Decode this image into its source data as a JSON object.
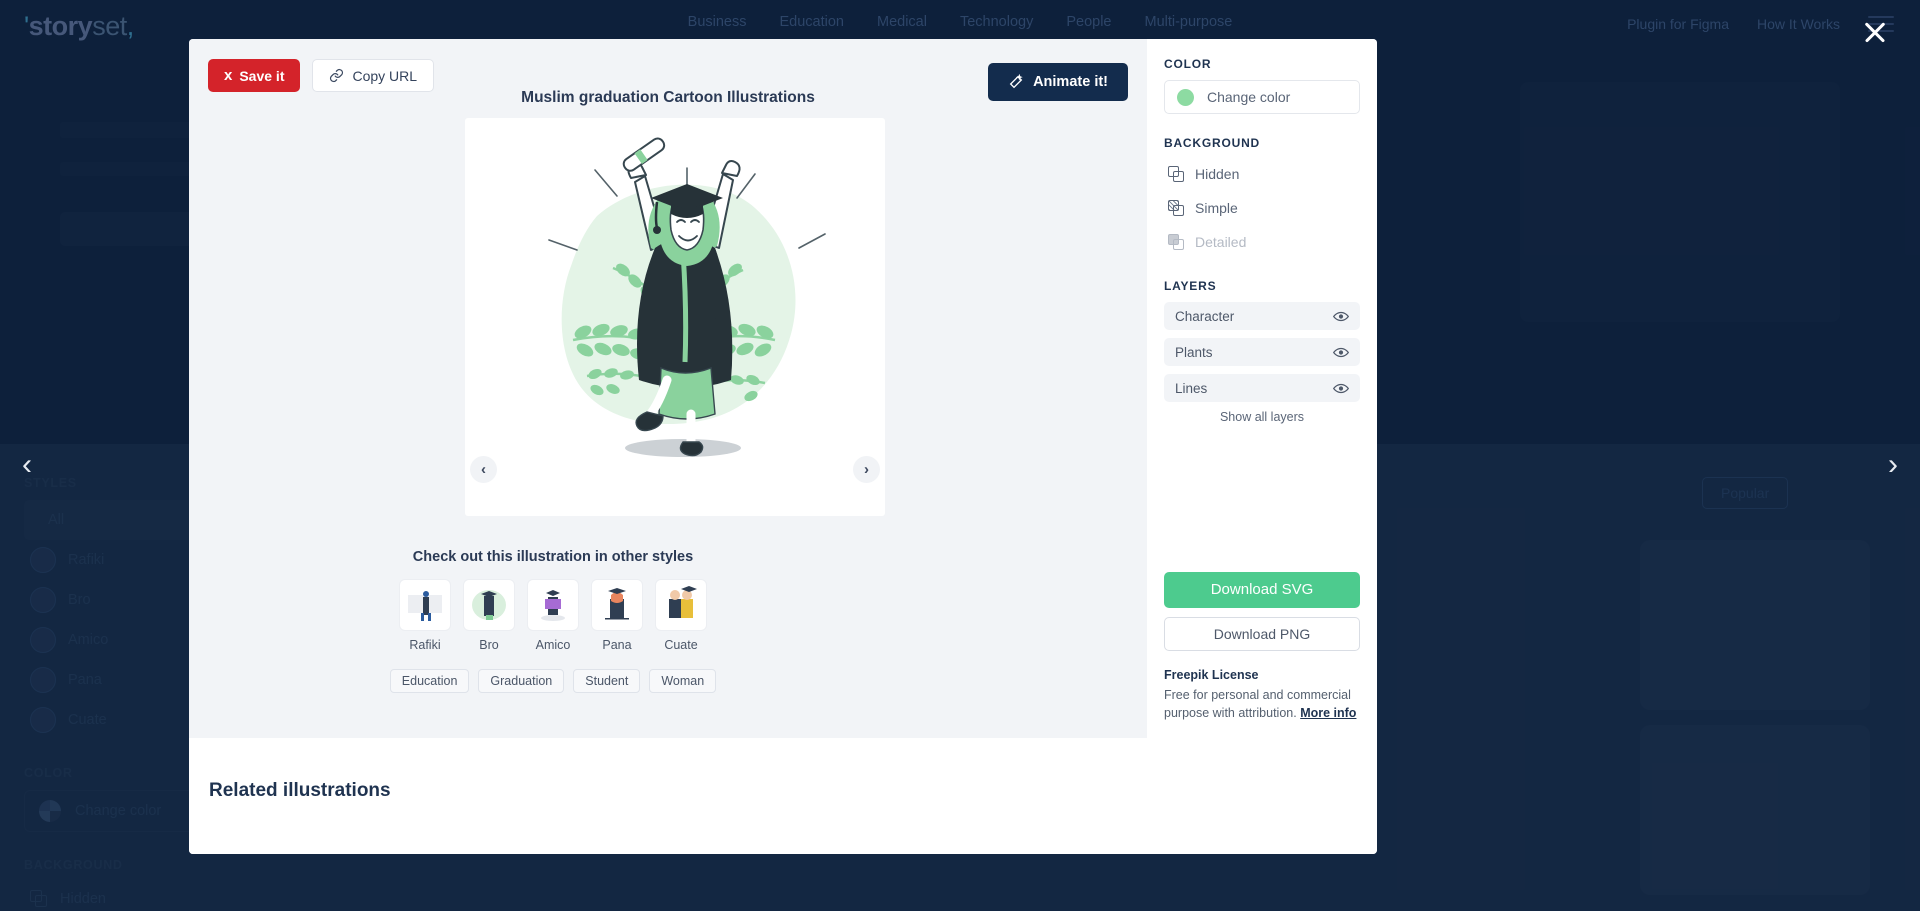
{
  "background": {
    "logo": {
      "pre": "'",
      "bold": "story",
      "light": "set",
      "tick": ","
    },
    "nav": [
      {
        "label": "Business"
      },
      {
        "label": "Education"
      },
      {
        "label": "Medical"
      },
      {
        "label": "Technology"
      },
      {
        "label": "People"
      },
      {
        "label": "Multi-purpose"
      }
    ],
    "nav_right": [
      {
        "label": "Plugin for Figma"
      },
      {
        "label": "How It Works"
      }
    ],
    "sidebar": {
      "styles_title": "STYLES",
      "styles": [
        {
          "label": "All",
          "active": true
        },
        {
          "label": "Rafiki",
          "active": false
        },
        {
          "label": "Bro",
          "active": false
        },
        {
          "label": "Amico",
          "active": false
        },
        {
          "label": "Pana",
          "active": false
        },
        {
          "label": "Cuate",
          "active": false
        }
      ],
      "color_title": "COLOR",
      "color_label": "Change color",
      "background_title": "BACKGROUND",
      "background_options": [
        {
          "label": "Hidden"
        }
      ]
    },
    "popular_button": "Popular"
  },
  "modal": {
    "actions": {
      "save_label": "Save it",
      "copy_label": "Copy URL",
      "animate_label": "Animate it!"
    },
    "title": "Muslim graduation Cartoon Illustrations",
    "other_styles_heading": "Check out this illustration in other styles",
    "style_thumbs": [
      {
        "label": "Rafiki"
      },
      {
        "label": "Bro"
      },
      {
        "label": "Amico"
      },
      {
        "label": "Pana"
      },
      {
        "label": "Cuate"
      }
    ],
    "tags": [
      {
        "label": "Education"
      },
      {
        "label": "Graduation"
      },
      {
        "label": "Student"
      },
      {
        "label": "Woman"
      }
    ],
    "related_heading": "Related illustrations",
    "panel": {
      "color_title": "COLOR",
      "color_label": "Change color",
      "color_swatch": "#8ddba2",
      "background_title": "BACKGROUND",
      "background_options": [
        {
          "label": "Hidden",
          "state": "normal"
        },
        {
          "label": "Simple",
          "state": "selected"
        },
        {
          "label": "Detailed",
          "state": "disabled"
        }
      ],
      "layers_title": "LAYERS",
      "layers": [
        {
          "label": "Character"
        },
        {
          "label": "Plants"
        },
        {
          "label": "Lines"
        }
      ],
      "show_all_layers": "Show all layers",
      "download_svg": "Download SVG",
      "download_png": "Download PNG",
      "license_title": "Freepik License",
      "license_body": "Free for personal and commercial purpose with attribution. ",
      "license_link": "More info"
    }
  },
  "colors": {
    "navy": "#13294b",
    "modal_bg": "#f2f4f7",
    "green": "#4dcb8e",
    "pinterest_red": "#d4232a",
    "illustration_green": "#7ecb94",
    "illustration_dark": "#263238"
  }
}
